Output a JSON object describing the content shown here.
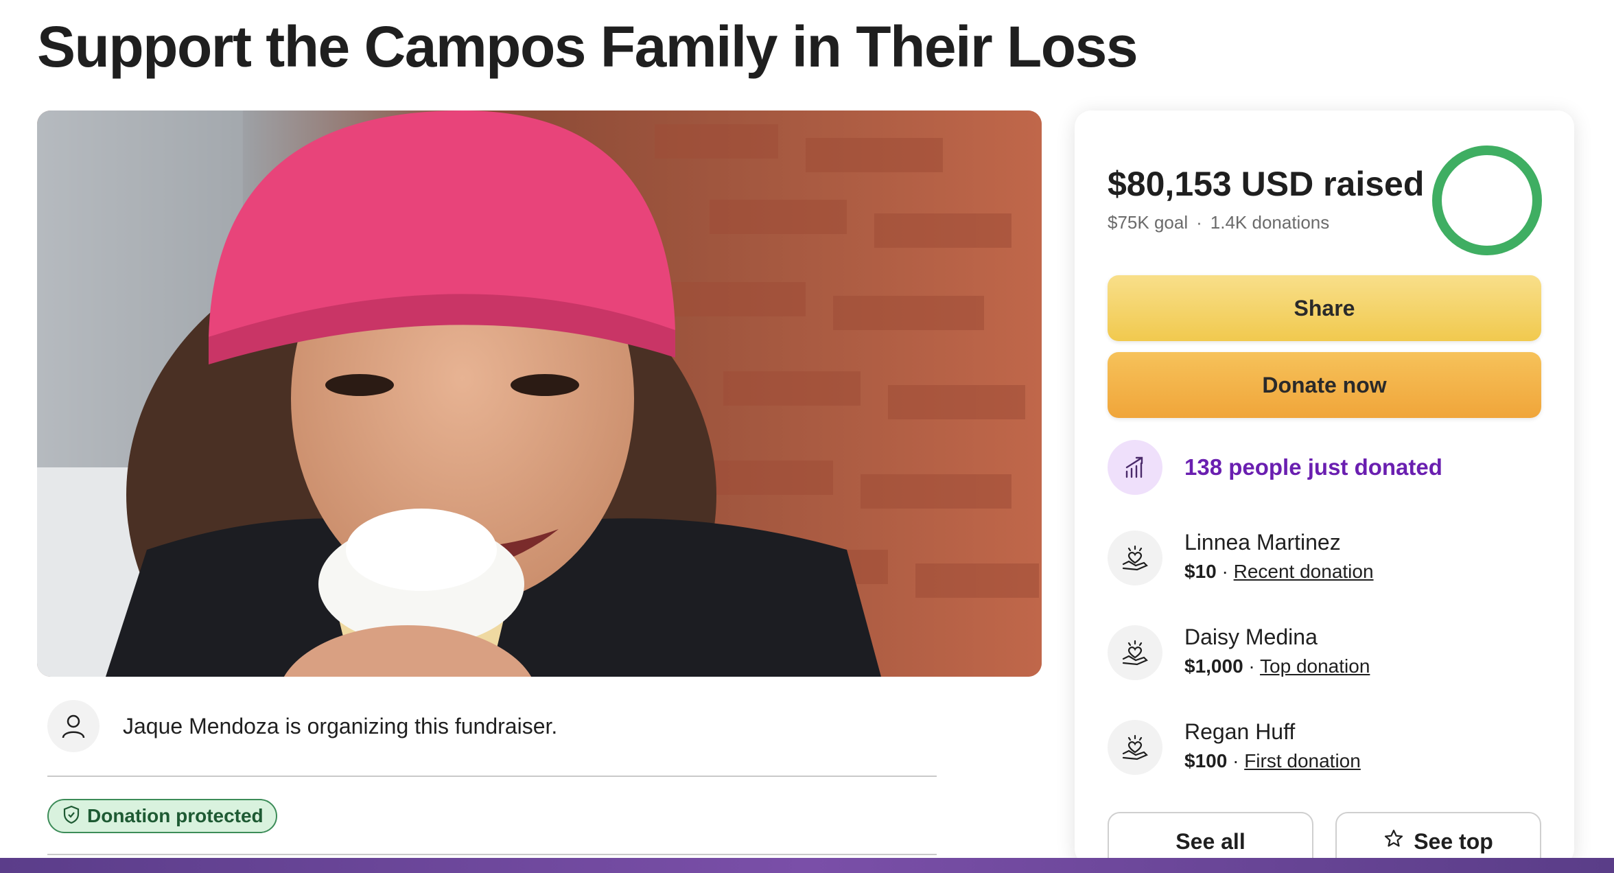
{
  "page": {
    "title": "Support the Campos Family in Their Loss"
  },
  "organizer": {
    "text": "Jaque Mendoza is organizing this fundraiser.",
    "icon": "user-icon"
  },
  "badge": {
    "label": "Donation protected",
    "icon": "shield-icon"
  },
  "summary": {
    "raised": "$80,153 USD raised",
    "goal": "$75K goal",
    "donations": "1.4K donations",
    "progress_fraction": 1.0
  },
  "actions": {
    "share_label": "Share",
    "donate_label": "Donate now"
  },
  "trend": {
    "text": "138 people just donated",
    "icon": "trending-up-icon"
  },
  "donors": [
    {
      "name": "Linnea Martinez",
      "amount": "$10",
      "tag": "Recent donation"
    },
    {
      "name": "Daisy Medina",
      "amount": "$1,000",
      "tag": "Top donation"
    },
    {
      "name": "Regan Huff",
      "amount": "$100",
      "tag": "First donation"
    }
  ],
  "footer_buttons": {
    "see_all": "See all",
    "see_top": "See top"
  },
  "colors": {
    "share": "#f1c94e",
    "donate": "#f0a53a",
    "trend_text": "#6a1fb0",
    "progress": "#3fae62",
    "badge_bg": "#d9f2de"
  }
}
